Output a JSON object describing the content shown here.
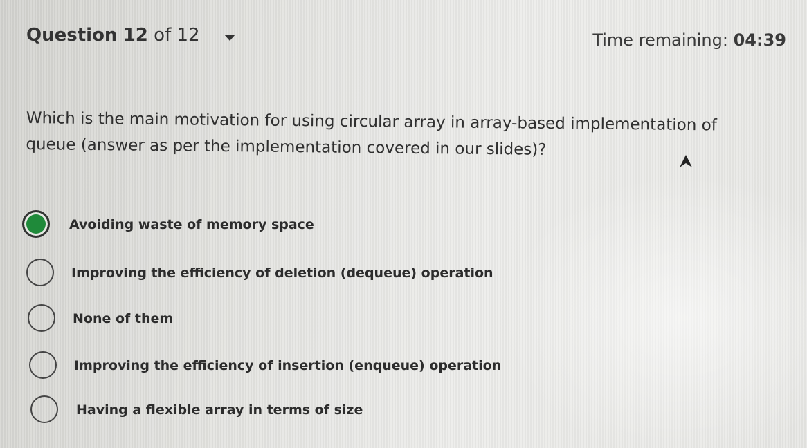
{
  "header": {
    "question_word": "Question",
    "question_number": "12",
    "question_of": "of 12",
    "timer_label": "Time remaining:",
    "timer_value": "04:39"
  },
  "question": {
    "text": "Which is the main motivation for using circular array in array-based implementation of queue (answer as per the implementation covered in our slides)?"
  },
  "options": [
    {
      "label": "Avoiding waste of memory space",
      "selected": true
    },
    {
      "label": "Improving the efficiency of deletion (dequeue) operation",
      "selected": false
    },
    {
      "label": "None of them",
      "selected": false
    },
    {
      "label": "Improving the efficiency of insertion (enqueue) operation",
      "selected": false
    },
    {
      "label": "Having a flexible array in terms of size",
      "selected": false
    }
  ],
  "colors": {
    "selected_radio": "#1f8a3a",
    "text": "#2c2c2c"
  },
  "icons": {
    "dropdown": "caret-down-icon",
    "cursor": "mouse-cursor-icon"
  }
}
